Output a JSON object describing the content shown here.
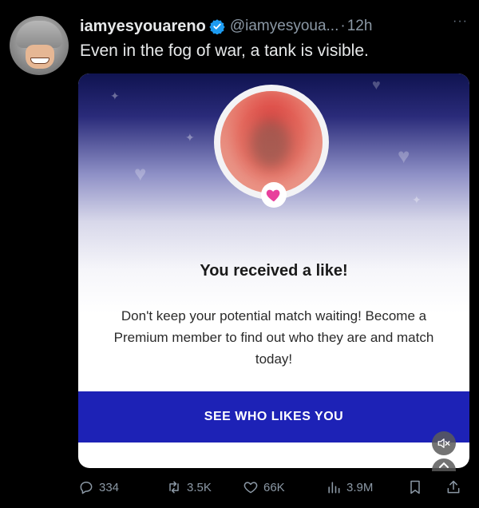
{
  "tweet": {
    "display_name": "iamyesyouareno",
    "handle": "@iamyesyoua...",
    "separator": "·",
    "time": "12h",
    "more": "···",
    "text": "Even in the fog of war, a tank is visible."
  },
  "card": {
    "title": "You received a like!",
    "body": "Don't keep your potential match waiting! Become a Premium member to find out who they are and match today!",
    "cta_label": "SEE WHO LIKES YOU",
    "cta_color": "#1d22b6",
    "heart_color": "#e8409c"
  },
  "actions": {
    "replies": "334",
    "reposts": "3.5K",
    "likes": "66K",
    "views": "3.9M"
  },
  "icons": [
    "verified-badge-icon",
    "reply-icon",
    "repost-icon",
    "like-icon",
    "views-icon",
    "bookmark-icon",
    "share-icon",
    "mute-icon"
  ]
}
